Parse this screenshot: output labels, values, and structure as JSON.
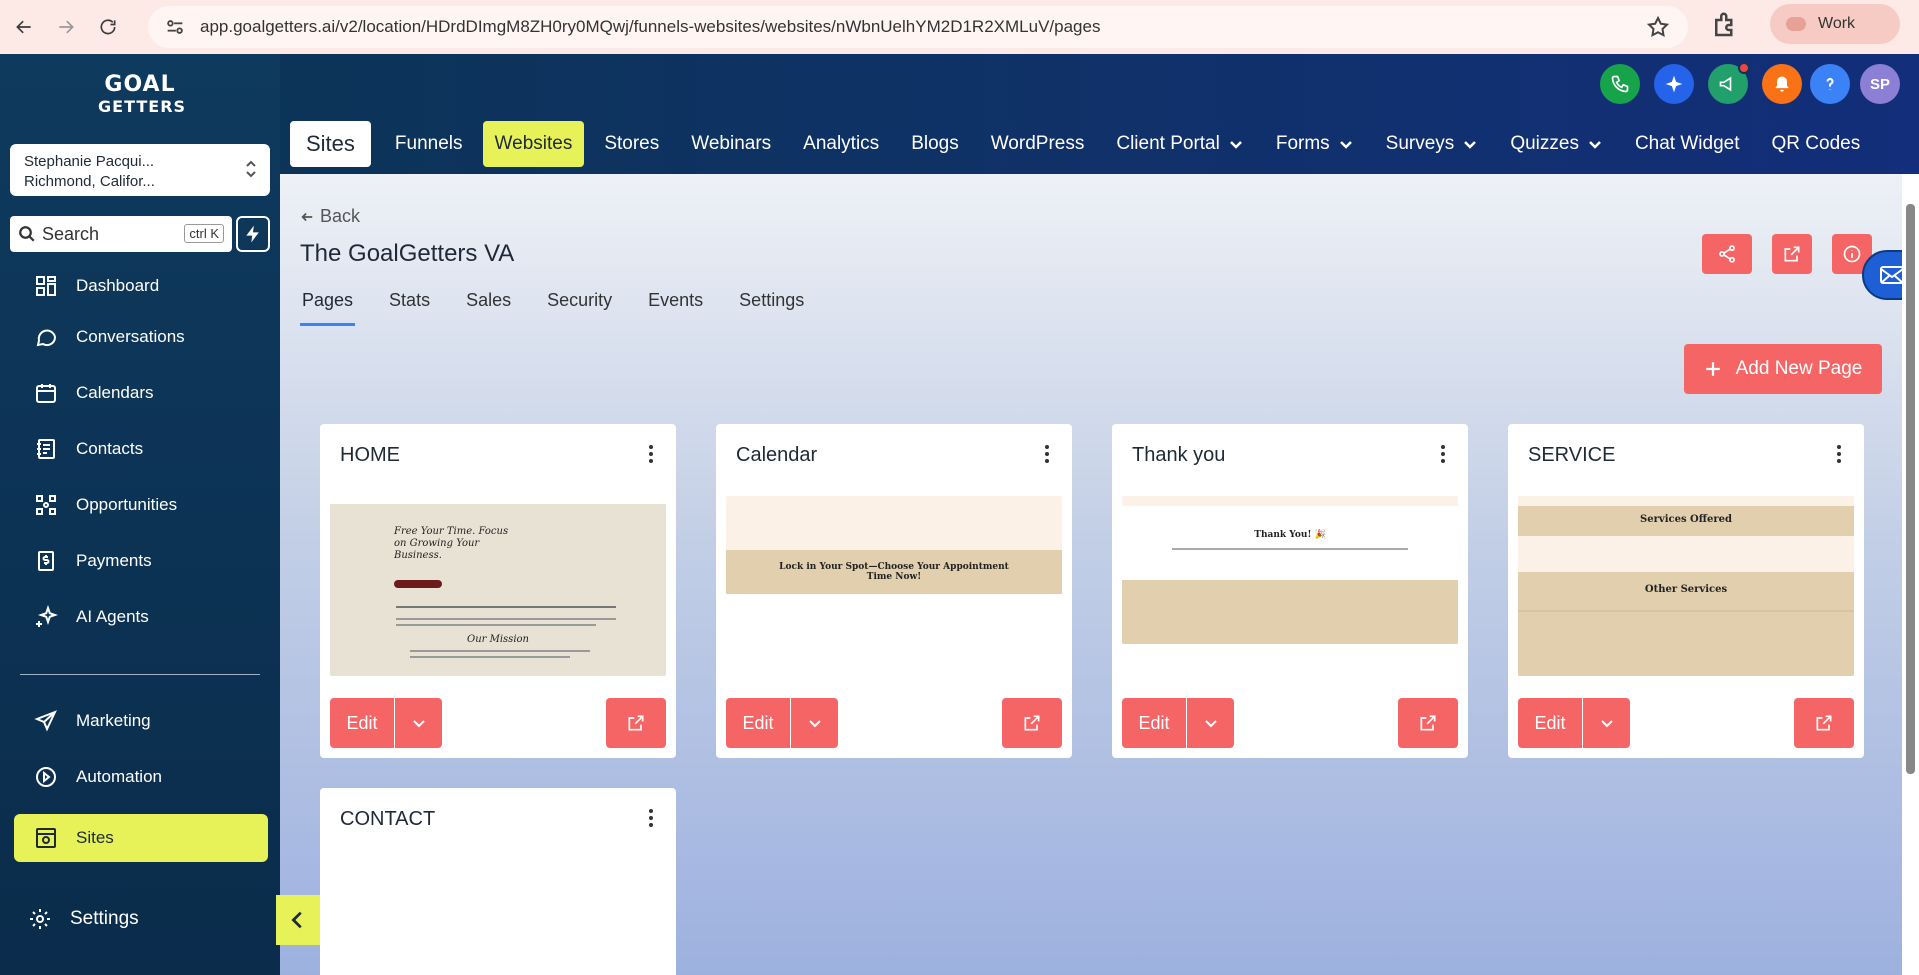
{
  "browser": {
    "url": "app.goalgetters.ai/v2/location/HDrdDImgM8ZH0ry0MQwj/funnels-websites/websites/nWbnUelhYM2D1R2XMLuV/pages",
    "profile": "Work"
  },
  "sidebar": {
    "logo_line1": "GOAL",
    "logo_line2": "GETTERS",
    "account_name": "Stephanie Pacqui...",
    "account_location": "Richmond, Califor...",
    "search_placeholder": "Search",
    "search_shortcut": "ctrl K",
    "items": [
      {
        "label": "Dashboard",
        "icon": "dashboard-icon"
      },
      {
        "label": "Conversations",
        "icon": "chat-bubble-icon"
      },
      {
        "label": "Calendars",
        "icon": "calendar-icon"
      },
      {
        "label": "Contacts",
        "icon": "contacts-icon"
      },
      {
        "label": "Opportunities",
        "icon": "opportunities-icon"
      },
      {
        "label": "Payments",
        "icon": "payments-icon"
      },
      {
        "label": "AI Agents",
        "icon": "sparkle-icon"
      },
      {
        "label": "Marketing",
        "icon": "send-icon"
      },
      {
        "label": "Automation",
        "icon": "automation-icon"
      },
      {
        "label": "Sites",
        "icon": "sites-icon"
      }
    ],
    "settings_label": "Settings"
  },
  "header": {
    "avatar_initials": "SP",
    "sites_label": "Sites",
    "tabs": [
      {
        "label": "Funnels"
      },
      {
        "label": "Websites"
      },
      {
        "label": "Stores"
      },
      {
        "label": "Webinars"
      },
      {
        "label": "Analytics"
      },
      {
        "label": "Blogs"
      },
      {
        "label": "WordPress"
      },
      {
        "label": "Client Portal"
      },
      {
        "label": "Forms"
      },
      {
        "label": "Surveys"
      },
      {
        "label": "Quizzes"
      },
      {
        "label": "Chat Widget"
      },
      {
        "label": "QR Codes"
      }
    ],
    "active_tab": "Websites"
  },
  "main": {
    "back_label": "Back",
    "title": "The GoalGetters VA",
    "sub_tabs": [
      "Pages",
      "Stats",
      "Sales",
      "Security",
      "Events",
      "Settings"
    ],
    "active_sub_tab": "Pages",
    "add_page_label": "Add New Page",
    "edit_label": "Edit",
    "pages": [
      {
        "title": "HOME",
        "thumb_heading": "Free Your Time. Focus on Growing Your Business.",
        "thumb_subheading": "Our Mission"
      },
      {
        "title": "Calendar",
        "thumb_heading": "Lock in Your Spot—Choose Your Appointment Time Now!"
      },
      {
        "title": "Thank you",
        "thumb_heading": "Thank You! 🎉"
      },
      {
        "title": "SERVICE",
        "thumb_heading": "Services Offered",
        "thumb_subheading": "Other Services"
      },
      {
        "title": "CONTACT"
      }
    ]
  },
  "colors": {
    "accent": "#f56565",
    "highlight": "#e6f257",
    "sidebar_bg": "#0e3a5e"
  }
}
